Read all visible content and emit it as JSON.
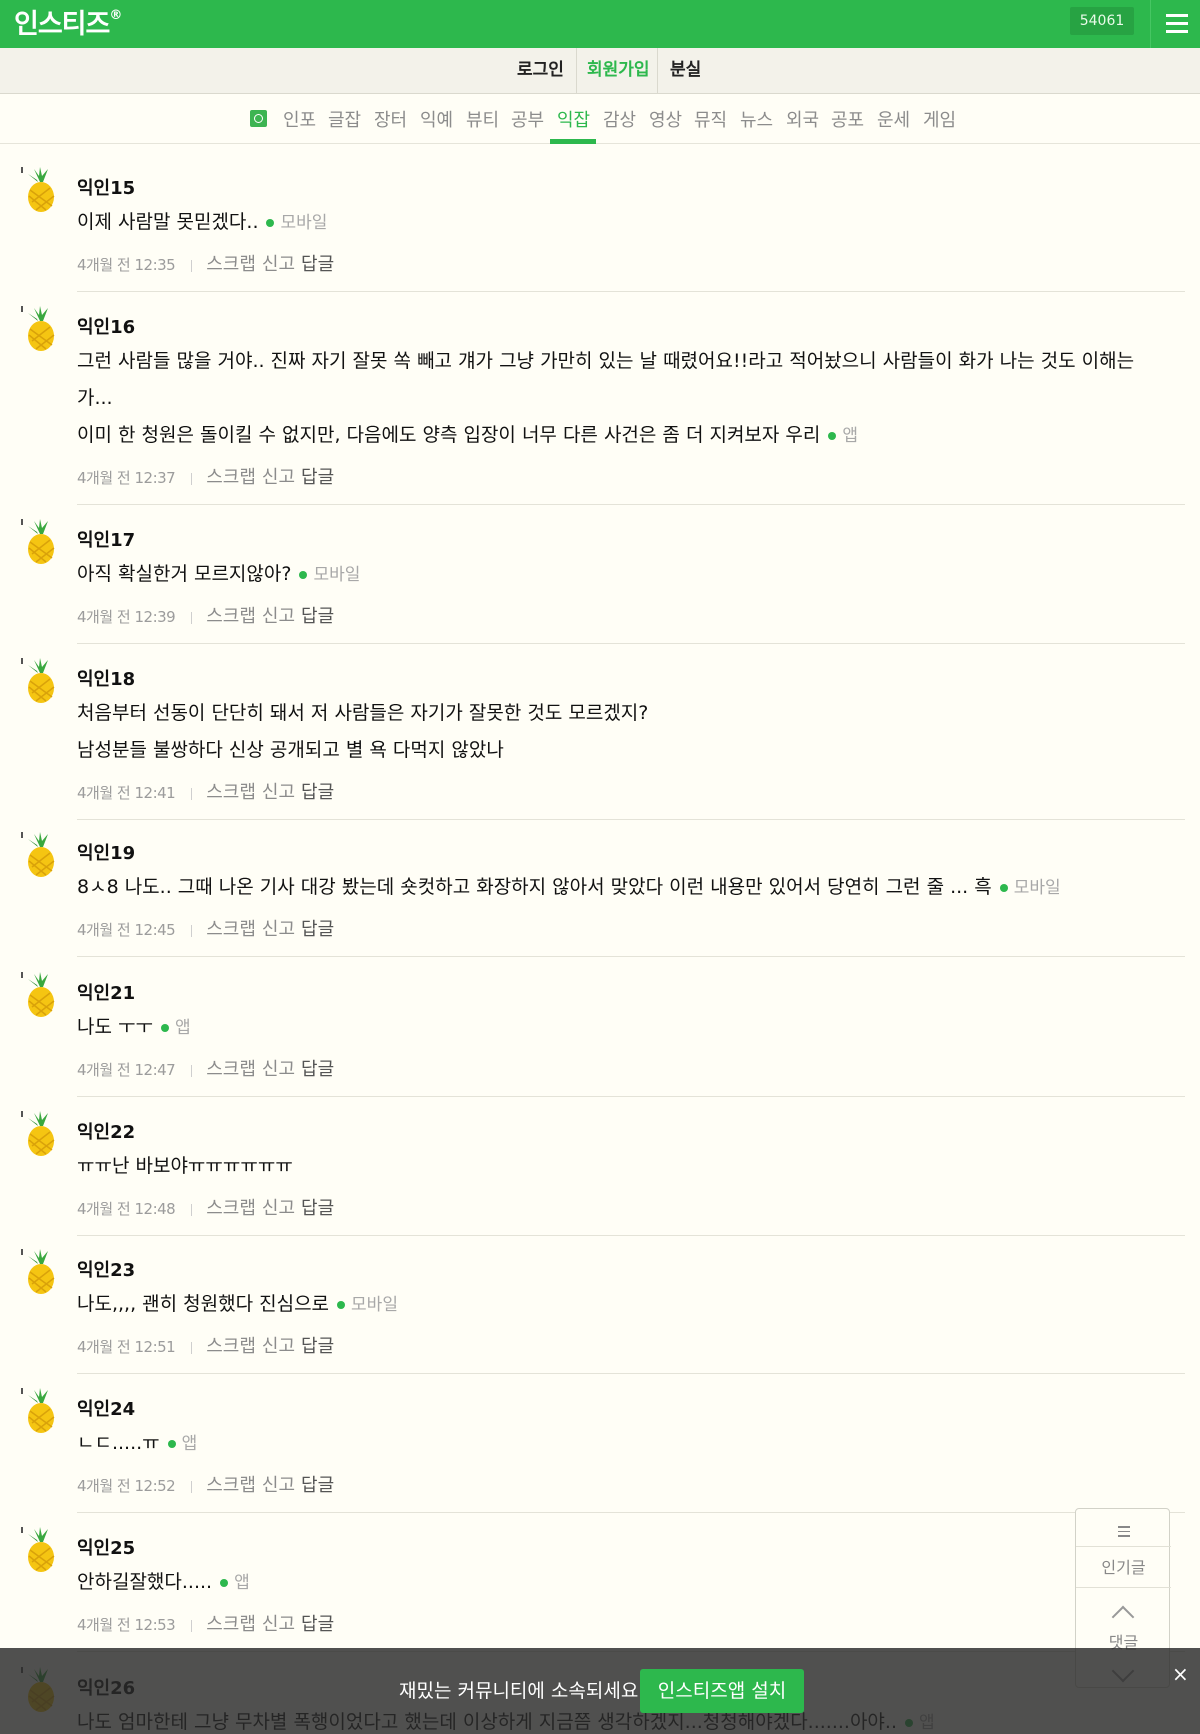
{
  "header": {
    "logo": "인스티즈",
    "logo_mark": "®",
    "count_badge": "54061",
    "menu_icon": "hamburger-icon"
  },
  "account_links": {
    "login": "로그인",
    "signup": "회원가입",
    "lost": "분실"
  },
  "categories": [
    "인포",
    "글잡",
    "장터",
    "익예",
    "뷰티",
    "공부",
    "익잡",
    "감상",
    "영상",
    "뮤직",
    "뉴스",
    "외국",
    "공포",
    "운세",
    "게임"
  ],
  "active_category": "익잡",
  "colors": {
    "brand_green": "#2db84d",
    "background": "#fffef6"
  },
  "comments": [
    {
      "nick": "익인15",
      "lines": [
        "이제 사람말 못믿겠다.."
      ],
      "source": "모바일",
      "time": "4개월 전 12:35"
    },
    {
      "nick": "익인16",
      "lines": [
        "그런 사람들 많을 거야.. 진짜 자기 잘못 쏙 빼고 걔가 그냥 가만히 있는 날 때렸어요!!라고 적어놨으니 사람들이 화가 나는 것도 이해는",
        "가...",
        "이미 한 청원은 돌이킬 수 없지만, 다음에도 양측 입장이 너무 다른 사건은 좀 더 지켜보자 우리"
      ],
      "source": "앱",
      "time": "4개월 전 12:37"
    },
    {
      "nick": "익인17",
      "lines": [
        "아직 확실한거 모르지않아?"
      ],
      "source": "모바일",
      "time": "4개월 전 12:39"
    },
    {
      "nick": "익인18",
      "lines": [
        "처음부터 선동이 단단히 돼서 저 사람들은 자기가 잘못한 것도 모르겠지?",
        "남성분들 불쌍하다 신상 공개되고 별 욕 다먹지 않았나"
      ],
      "source": "",
      "time": "4개월 전 12:41"
    },
    {
      "nick": "익인19",
      "lines": [
        "8ㅅ8 나도.. 그때 나온 기사 대강 봤는데 숏컷하고 화장하지 않아서 맞았다 이런 내용만 있어서 당연히 그런 줄 ... 흑"
      ],
      "source": "모바일",
      "time": "4개월 전 12:45"
    },
    {
      "nick": "익인21",
      "lines": [
        "나도 ㅜㅜ"
      ],
      "source": "앱",
      "time": "4개월 전 12:47"
    },
    {
      "nick": "익인22",
      "lines": [
        "ㅠㅠ난 바보야ㅠㅠㅠㅠㅠㅠ"
      ],
      "source": "",
      "time": "4개월 전 12:48"
    },
    {
      "nick": "익인23",
      "lines": [
        "나도,,,, 괜히 청원했다 진심으로"
      ],
      "source": "모바일",
      "time": "4개월 전 12:51"
    },
    {
      "nick": "익인24",
      "lines": [
        "ㄴㄷ.....ㅠ"
      ],
      "source": "앱",
      "time": "4개월 전 12:52"
    },
    {
      "nick": "익인25",
      "lines": [
        "안하길잘했다....."
      ],
      "source": "앱",
      "time": "4개월 전 12:53"
    },
    {
      "nick": "익인26",
      "lines": [
        "나도 엄마한테 그냥 무차별 폭행이었다고 했는데 이상하게 지금쯤 생각하겠지...청청해야겠다.......아야.."
      ],
      "source": "앱",
      "time": ""
    }
  ],
  "comment_actions": {
    "scrap": "스크랩",
    "report": "신고",
    "reply": "답글"
  },
  "side_nav": {
    "popular": "인기글",
    "comments": "댓글"
  },
  "banner": {
    "text": "재밌는 커뮤니티에 소속되세요!",
    "button": "인스티즈앱 설치",
    "close": "×"
  }
}
